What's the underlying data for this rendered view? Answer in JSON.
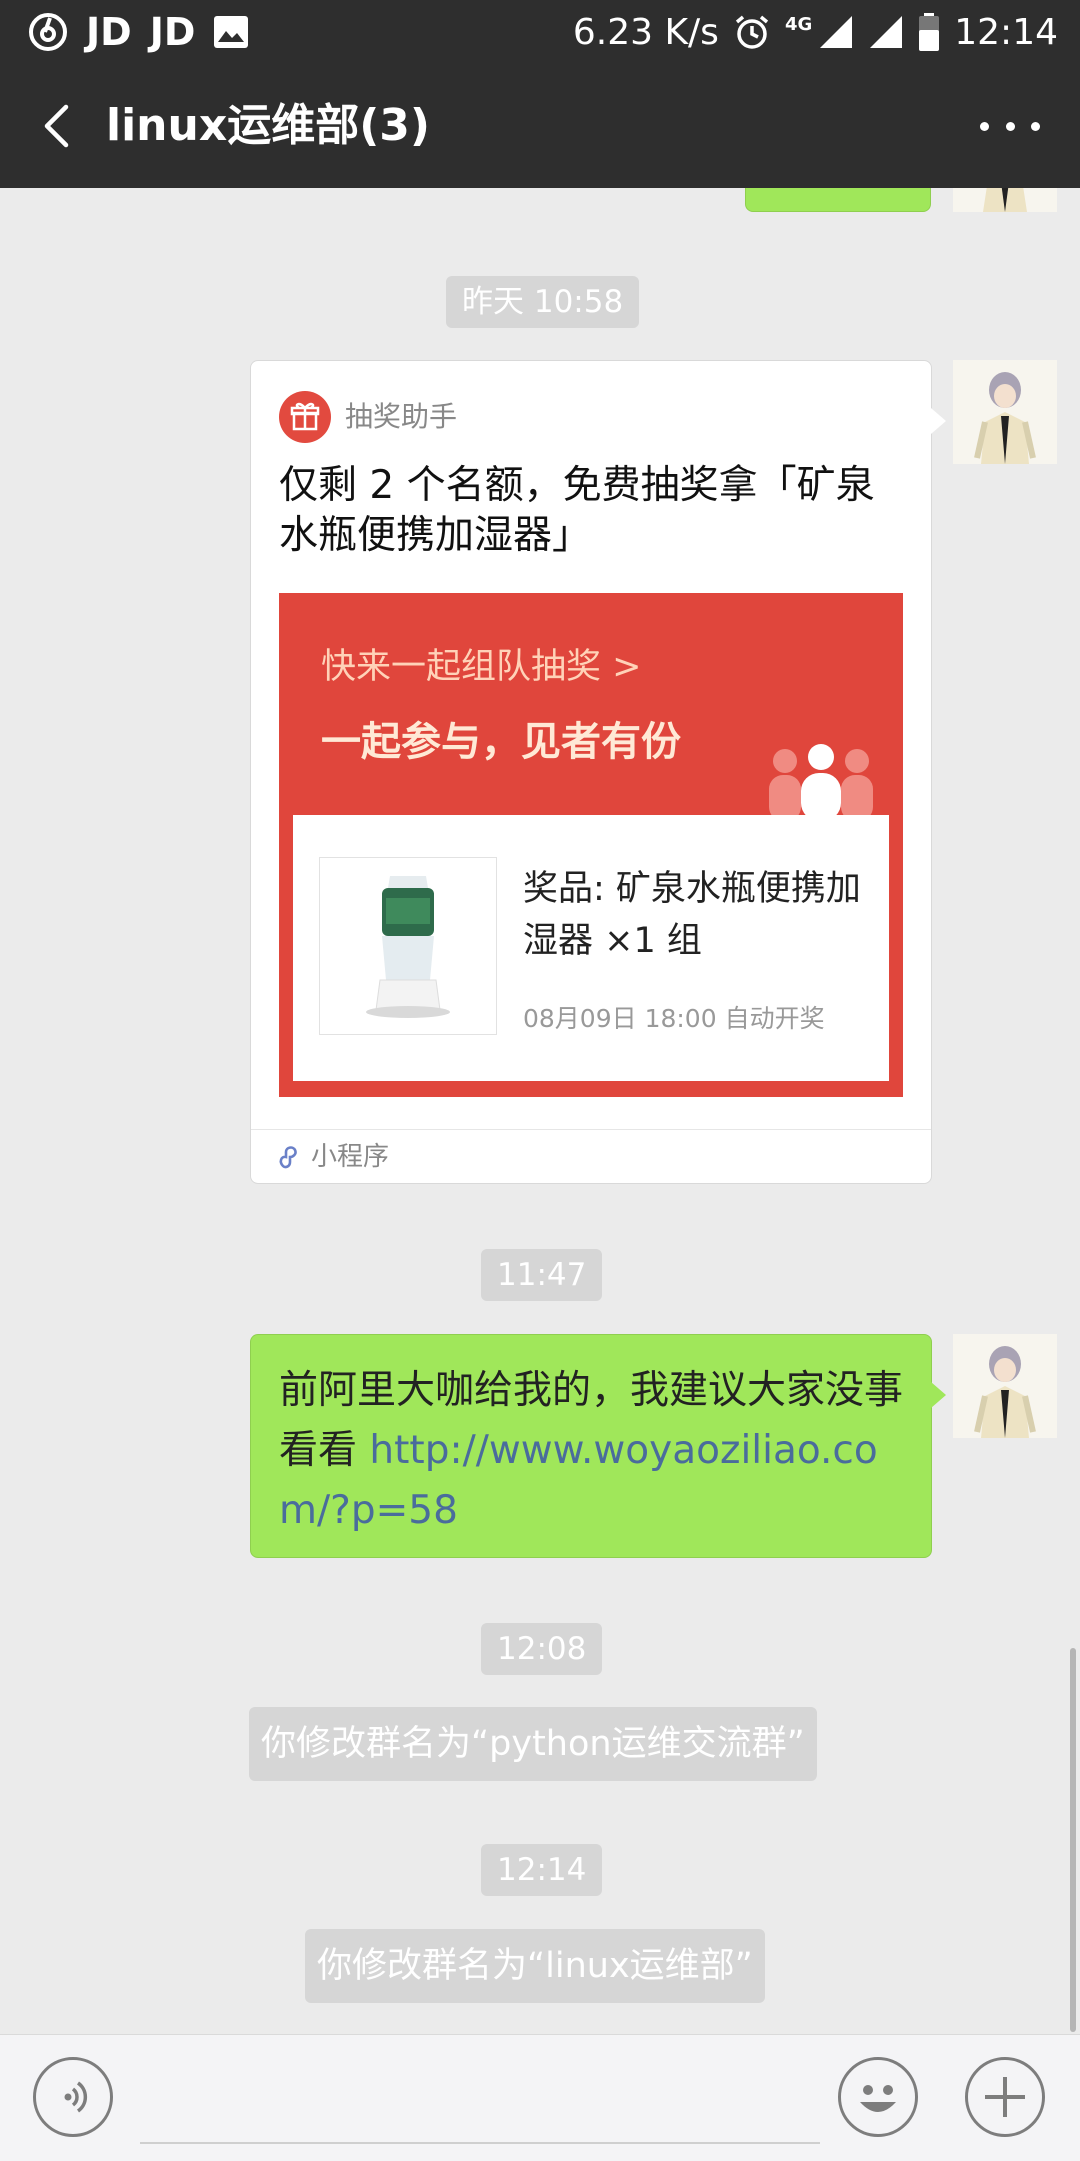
{
  "status_bar": {
    "app_labels": [
      "JD",
      "JD"
    ],
    "network_speed": "6.23 K/s",
    "network_type": "4G",
    "time": "12:14"
  },
  "nav": {
    "title": "linux运维部(3)"
  },
  "chat": {
    "time_1": "昨天 10:58",
    "card": {
      "app_name": "抽奖助手",
      "title": "仅剩 2 个名额，免费抽奖拿「矿泉水瓶便携加湿器」",
      "banner_line_1": "快来一起组队抽奖 >",
      "banner_line_2": "一起参与，见者有份",
      "prize_name": "奖品: 矿泉水瓶便携加湿器 ×1 组",
      "prize_time": "08月09日 18:00 自动开奖",
      "footer_label": "小程序"
    },
    "time_2": "11:47",
    "message": {
      "text": "前阿里大咖给我的，我建议大家没事看看 ",
      "link": "http://www.woyaoziliao.com/?p=58"
    },
    "time_3": "12:08",
    "system_1": "你修改群名为“python运维交流群”",
    "time_4": "12:14",
    "system_2": "你修改群名为“linux运维部”"
  },
  "colors": {
    "header_bg": "#2e2e2e",
    "chat_bg": "#ebebeb",
    "bubble_green": "#a0e75a",
    "banner_red": "#e0463c",
    "link_blue": "#4a6c9c"
  },
  "icons": [
    "netease-music-icon",
    "image-icon",
    "alarm-icon",
    "signal-icon",
    "battery-icon",
    "back-icon",
    "more-icon",
    "gift-icon",
    "mini-program-icon",
    "voice-icon",
    "emoji-icon",
    "plus-icon"
  ]
}
